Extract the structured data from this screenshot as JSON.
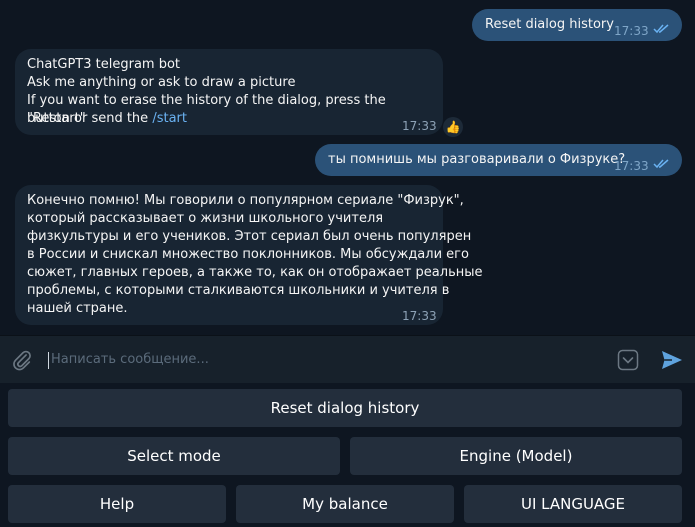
{
  "messages": [
    {
      "from": "me",
      "text": "Reset dialog history",
      "time": "17:33"
    },
    {
      "from": "bot",
      "lines": [
        "ChatGPT3 telegram bot",
        "Ask me anything or ask to draw a picture",
        "If you want to erase the history of the dialog, press the \"Restart\"",
        "button or send the "
      ],
      "link": "/start",
      "time": "17:33",
      "reaction": "👍"
    },
    {
      "from": "me",
      "text": "ты помнишь мы разговаривали о Физруке?",
      "time": "17:33"
    },
    {
      "from": "bot",
      "lines": [
        "Конечно помню! Мы говорили о популярном сериале \"Физрук\",",
        "который рассказывает о жизни школьного учителя",
        "физкультуры и его учеников. Этот сериал был очень популярен",
        "в России и снискал множество поклонников. Мы обсуждали его",
        "сюжет, главных героев, а также то, как он отображает реальные",
        "проблемы, с которыми сталкиваются школьники и учителя в",
        "нашей стране."
      ],
      "time": "17:33"
    }
  ],
  "input": {
    "placeholder": "Написать сообщение..."
  },
  "keyboard": {
    "row1": [
      "Reset dialog history"
    ],
    "row2": [
      "Select mode",
      "Engine (Model)"
    ],
    "row3": [
      "Help",
      "My balance",
      "UI LANGUAGE"
    ]
  },
  "icons": {
    "attach": "paperclip-icon",
    "keyboard_toggle": "chevron-down-icon",
    "send": "send-icon",
    "read": "double-check-icon"
  },
  "colors": {
    "background": "#0e1621",
    "outgoing_bubble": "#2b5278",
    "incoming_bubble": "#182533",
    "input_bar": "#17212b",
    "keyboard_button": "#232e3c",
    "link": "#6ab2f2",
    "send": "#5fa3de"
  }
}
